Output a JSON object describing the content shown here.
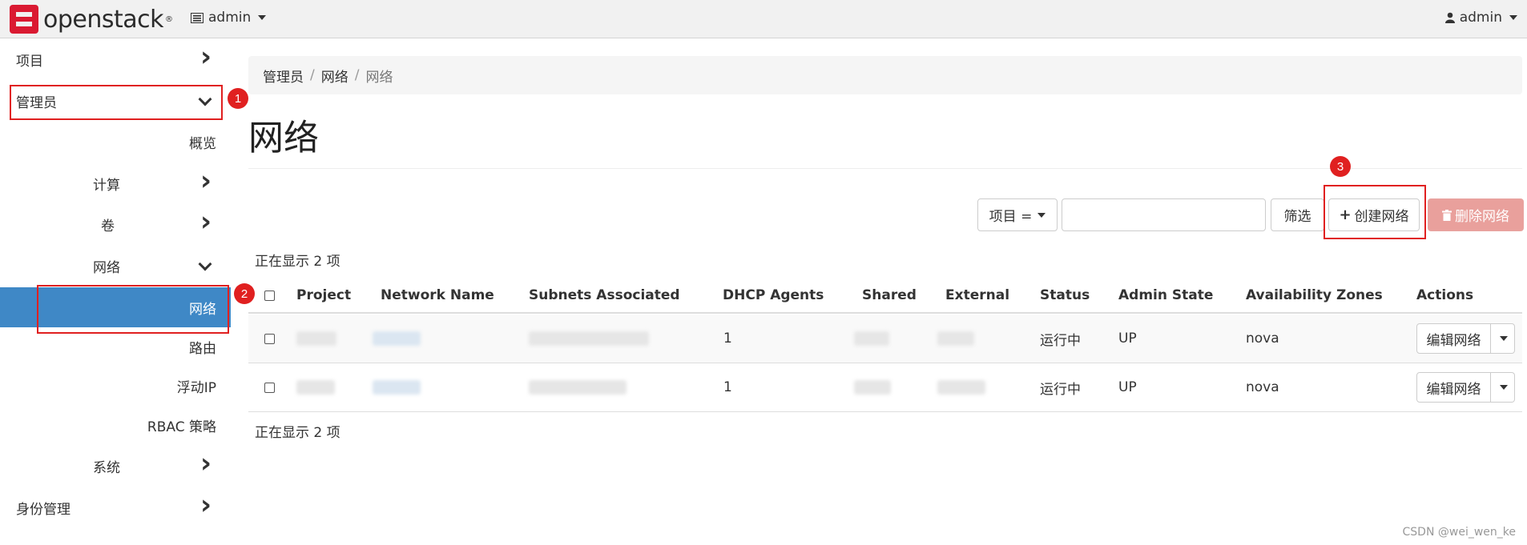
{
  "topbar": {
    "logo_text": "openstack",
    "logo_mark": "®",
    "project_label": "admin",
    "user_label": "admin"
  },
  "sidebar": {
    "items": [
      {
        "label": "项目",
        "chevron": "right"
      },
      {
        "label": "管理员",
        "chevron": "down"
      },
      {
        "label": "概览"
      },
      {
        "label": "计算",
        "chevron": "right"
      },
      {
        "label": "卷",
        "chevron": "right"
      },
      {
        "label": "网络",
        "chevron": "down"
      },
      {
        "label": "网络",
        "active": true
      },
      {
        "label": "路由"
      },
      {
        "label": "浮动IP"
      },
      {
        "label": "RBAC 策略"
      },
      {
        "label": "系统",
        "chevron": "right"
      },
      {
        "label": "身份管理",
        "chevron": "right"
      }
    ]
  },
  "breadcrumb": [
    "管理员",
    "网络",
    "网络"
  ],
  "page_title": "网络",
  "toolbar": {
    "filter_field": "项目 =",
    "filter_button": "筛选",
    "create_button": "创建网络",
    "delete_button": "删除网络"
  },
  "count_text": "正在显示 2 项",
  "table": {
    "headers": [
      "Project",
      "Network Name",
      "Subnets Associated",
      "DHCP Agents",
      "Shared",
      "External",
      "Status",
      "Admin State",
      "Availability Zones",
      "Actions"
    ],
    "rows": [
      {
        "dhcp": "1",
        "status": "运行中",
        "admin_state": "UP",
        "zone": "nova",
        "action": "编辑网络"
      },
      {
        "dhcp": "1",
        "status": "运行中",
        "admin_state": "UP",
        "zone": "nova",
        "action": "编辑网络"
      }
    ]
  },
  "annotations": [
    "1",
    "2",
    "3"
  ],
  "watermark": "CSDN @wei_wen_ke",
  "colors": {
    "active_nav": "#3f88c6",
    "brand_red": "#da1a32",
    "delete_button": "#e9a09c",
    "annotation_red": "#e02020"
  },
  "icons": [
    "list-icon",
    "user-icon",
    "chevron-right-icon",
    "chevron-down-icon",
    "plus-icon",
    "trash-icon",
    "caret-down-icon"
  ]
}
